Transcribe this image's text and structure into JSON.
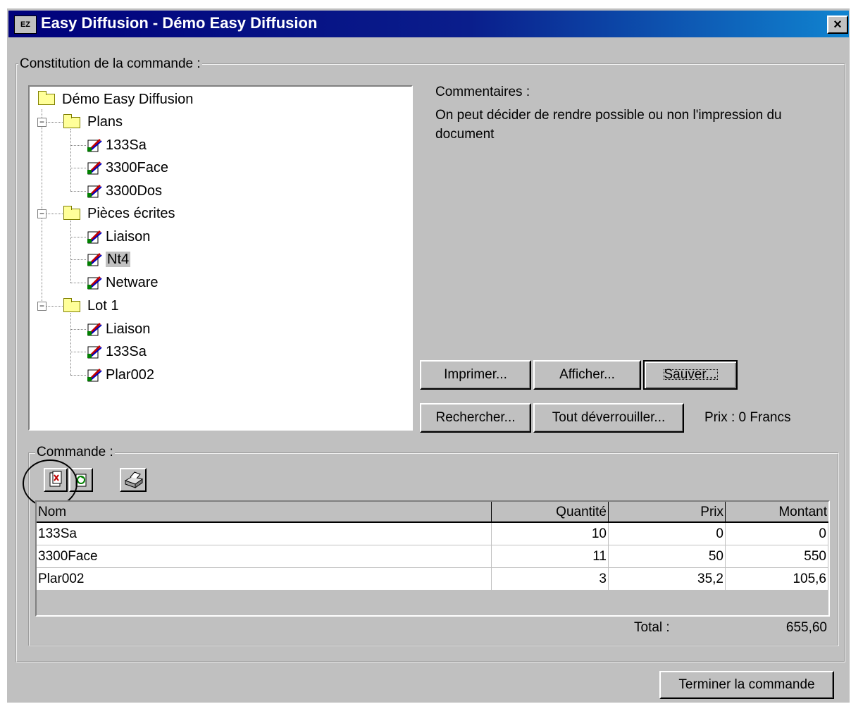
{
  "window": {
    "title": "Easy Diffusion - Démo Easy Diffusion",
    "app_icon_label": "EZ",
    "close_label": "×"
  },
  "constitution": {
    "group_label": "Constitution de la commande :",
    "tree": {
      "root": "Démo Easy Diffusion",
      "folders": [
        {
          "label": "Plans",
          "items": [
            "133Sa",
            "3300Face",
            "3300Dos"
          ]
        },
        {
          "label": "Pièces écrites",
          "items": [
            "Liaison",
            "Nt4",
            "Netware"
          ]
        },
        {
          "label": "Lot 1",
          "items": [
            "Liaison",
            "133Sa",
            "Plar002"
          ]
        }
      ],
      "selected_item": "Nt4"
    },
    "comments_label": "Commentaires :",
    "comments_text_line1": "On peut décider de rendre possible ou non l'impression du",
    "comments_text_line2": "document",
    "buttons": {
      "print": "Imprimer...",
      "show": "Afficher...",
      "save": "Sauver...",
      "search": "Rechercher...",
      "unlock_all": "Tout déverrouiller..."
    },
    "price_text": "Prix : 0 Francs"
  },
  "order": {
    "group_label": "Commande :",
    "toolbar": [
      "add-document-icon",
      "recycle-icon",
      "printer-icon"
    ],
    "columns": [
      "Nom",
      "Quantité",
      "Prix",
      "Montant"
    ],
    "rows": [
      [
        "133Sa",
        "10",
        "0",
        "0"
      ],
      [
        "3300Face",
        "11",
        "50",
        "550"
      ],
      [
        "Plar002",
        "3",
        "35,2",
        "105,6"
      ]
    ],
    "total_label": "Total :",
    "total_value": "655,60"
  },
  "finish_button": "Terminer la commande",
  "colors": {
    "titlebar_start": "#00007b",
    "titlebar_end": "#1084d0",
    "face": "#c0c0c0"
  }
}
